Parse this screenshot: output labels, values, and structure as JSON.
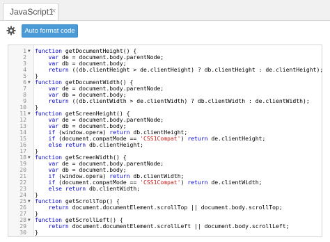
{
  "tab": {
    "title": "JavaScript1",
    "close": "×"
  },
  "toolbar": {
    "settings_icon": "gear-icon",
    "format_label": "Auto format code"
  },
  "editor": {
    "lines": [
      [
        [
          "kw",
          "function"
        ],
        [
          "p",
          " getDocumentHeight() {"
        ]
      ],
      [
        [
          "p",
          "    "
        ],
        [
          "kw",
          "var"
        ],
        [
          "p",
          " de = document.body.parentNode;"
        ]
      ],
      [
        [
          "p",
          "    "
        ],
        [
          "kw",
          "var"
        ],
        [
          "p",
          " db = document.body;"
        ]
      ],
      [
        [
          "p",
          "    "
        ],
        [
          "kw",
          "return"
        ],
        [
          "p",
          " ((db.clientHeight > de.clientHeight) ? db.clientHeight : de.clientHeight);"
        ]
      ],
      [
        [
          "p",
          "}"
        ]
      ],
      [
        [
          "kw",
          "function"
        ],
        [
          "p",
          " getDocumentWidth() {"
        ]
      ],
      [
        [
          "p",
          "    "
        ],
        [
          "kw",
          "var"
        ],
        [
          "p",
          " de = document.body.parentNode;"
        ]
      ],
      [
        [
          "p",
          "    "
        ],
        [
          "kw",
          "var"
        ],
        [
          "p",
          " db = document.body;"
        ]
      ],
      [
        [
          "p",
          "    "
        ],
        [
          "kw",
          "return"
        ],
        [
          "p",
          " ((db.clientWidth > de.clientWidth) ? db.clientWidth : de.clientWidth);"
        ]
      ],
      [
        [
          "p",
          "}"
        ]
      ],
      [
        [
          "kw",
          "function"
        ],
        [
          "p",
          " getScreenHeight() {"
        ]
      ],
      [
        [
          "p",
          "    "
        ],
        [
          "kw",
          "var"
        ],
        [
          "p",
          " de = document.body.parentNode;"
        ]
      ],
      [
        [
          "p",
          "    "
        ],
        [
          "kw",
          "var"
        ],
        [
          "p",
          " db = document.body;"
        ]
      ],
      [
        [
          "p",
          "    "
        ],
        [
          "kw",
          "if"
        ],
        [
          "p",
          " (window.opera) "
        ],
        [
          "kw",
          "return"
        ],
        [
          "p",
          " db.clientHeight;"
        ]
      ],
      [
        [
          "p",
          "    "
        ],
        [
          "kw",
          "if"
        ],
        [
          "p",
          " (document.compatMode == "
        ],
        [
          "str",
          "'CSS1Compat'"
        ],
        [
          "p",
          ") "
        ],
        [
          "kw",
          "return"
        ],
        [
          "p",
          " de.clientHeight;"
        ]
      ],
      [
        [
          "p",
          "    "
        ],
        [
          "kw",
          "else"
        ],
        [
          "p",
          " "
        ],
        [
          "kw",
          "return"
        ],
        [
          "p",
          " db.clientHeight;"
        ]
      ],
      [
        [
          "p",
          "}"
        ]
      ],
      [
        [
          "kw",
          "function"
        ],
        [
          "p",
          " getScreenWidth() {"
        ]
      ],
      [
        [
          "p",
          "    "
        ],
        [
          "kw",
          "var"
        ],
        [
          "p",
          " de = document.body.parentNode;"
        ]
      ],
      [
        [
          "p",
          "    "
        ],
        [
          "kw",
          "var"
        ],
        [
          "p",
          " db = document.body;"
        ]
      ],
      [
        [
          "p",
          "    "
        ],
        [
          "kw",
          "if"
        ],
        [
          "p",
          " (window.opera) "
        ],
        [
          "kw",
          "return"
        ],
        [
          "p",
          " db.clientWidth;"
        ]
      ],
      [
        [
          "p",
          "    "
        ],
        [
          "kw",
          "if"
        ],
        [
          "p",
          " (document.compatMode == "
        ],
        [
          "str",
          "'CSS1Compat'"
        ],
        [
          "p",
          ") "
        ],
        [
          "kw",
          "return"
        ],
        [
          "p",
          " de.clientWidth;"
        ]
      ],
      [
        [
          "p",
          "    "
        ],
        [
          "kw",
          "else"
        ],
        [
          "p",
          " "
        ],
        [
          "kw",
          "return"
        ],
        [
          "p",
          " db.clientWidth;"
        ]
      ],
      [
        [
          "p",
          "}"
        ]
      ],
      [
        [
          "kw",
          "function"
        ],
        [
          "p",
          " getScrollTop() {"
        ]
      ],
      [
        [
          "p",
          "    "
        ],
        [
          "kw",
          "return"
        ],
        [
          "p",
          " document.documentElement.scrollTop || document.body.scrollTop;"
        ]
      ],
      [
        [
          "p",
          "}"
        ]
      ],
      [
        [
          "kw",
          "function"
        ],
        [
          "p",
          " getScrollLeft() {"
        ]
      ],
      [
        [
          "p",
          "    "
        ],
        [
          "kw",
          "return"
        ],
        [
          "p",
          " document.documentElement.scrollLeft || document.body.scrollLeft;"
        ]
      ],
      [
        [
          "p",
          "}"
        ]
      ]
    ],
    "fold_lines": [
      1,
      6,
      11,
      18,
      25,
      28
    ],
    "fold_marker": "▼"
  }
}
